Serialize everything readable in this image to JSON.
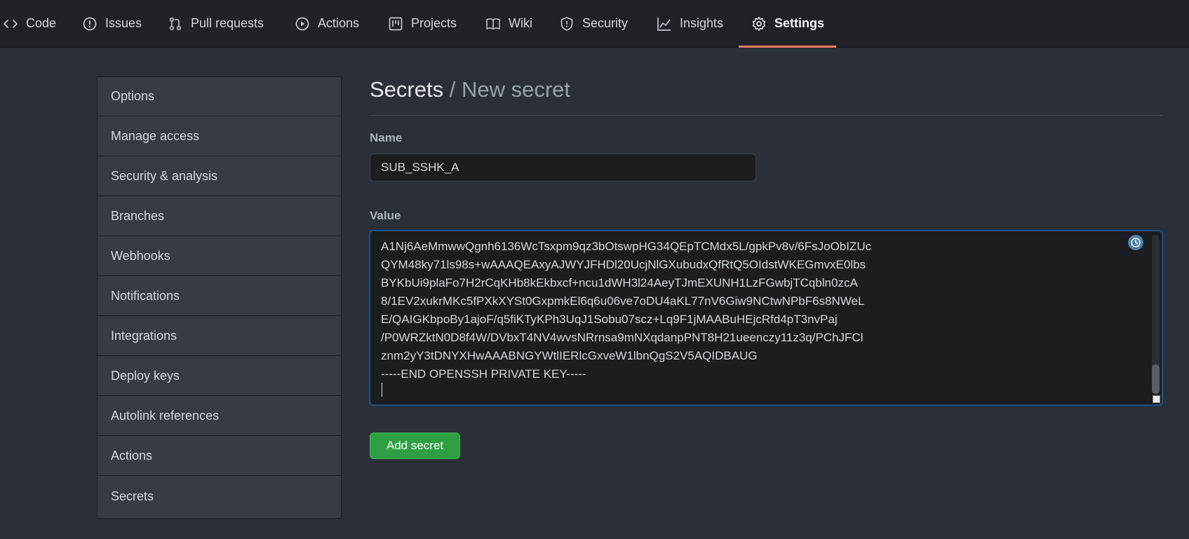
{
  "nav": {
    "tabs": [
      {
        "label": "Code",
        "icon": "code-icon"
      },
      {
        "label": "Issues",
        "icon": "issue-icon"
      },
      {
        "label": "Pull requests",
        "icon": "pull-request-icon"
      },
      {
        "label": "Actions",
        "icon": "play-icon"
      },
      {
        "label": "Projects",
        "icon": "project-icon"
      },
      {
        "label": "Wiki",
        "icon": "book-icon"
      },
      {
        "label": "Security",
        "icon": "shield-icon"
      },
      {
        "label": "Insights",
        "icon": "graph-icon"
      },
      {
        "label": "Settings",
        "icon": "gear-icon",
        "selected": true
      }
    ]
  },
  "sidebar": {
    "items": [
      {
        "label": "Options"
      },
      {
        "label": "Manage access"
      },
      {
        "label": "Security & analysis"
      },
      {
        "label": "Branches"
      },
      {
        "label": "Webhooks"
      },
      {
        "label": "Notifications"
      },
      {
        "label": "Integrations"
      },
      {
        "label": "Deploy keys"
      },
      {
        "label": "Autolink references"
      },
      {
        "label": "Actions"
      },
      {
        "label": "Secrets"
      }
    ]
  },
  "main": {
    "title": "Secrets",
    "title_sub": " / New secret",
    "name_label": "Name",
    "name_value": "SUB_SSHK_A",
    "value_label": "Value",
    "value_lines": [
      "A1Nj6AeMmwwQgnh6136WcTsxpm9qz3bOtswpHG34QEpTCMdx5L/gpkPv8v/6FsJoObIZUc",
      "QYM48ky71ls98s+wAAAQEAxyAJWYJFHDl20UcjNlGXubudxQfRtQ5OIdstWKEGmvxE0lbs",
      "BYKbUi9plaFo7H2rCqKHb8kEkbxcf+ncu1dWH3l24AeyTJmEXUNH1LzFGwbjTCqbln0zcA",
      "8/1EV2xukrMKc5fPXkXYSt0GxpmkEl6q6u06ve7oDU4aKL77nV6Giw9NCtwNPbF6s8NWeL",
      "E/QAIGKbpoBy1ajoF/q5fiKTyKPh3UqJ1Sobu07scz+Lq9F1jMAABuHEjcRfd4pT3nvPaj",
      "/P0WRZktN0D8f4W/DVbxT4NV4wvsNRrnsa9mNXqdanpPNT8H21ueenczy11z3q/PChJFCl",
      "znm2yY3tDNYXHwAAABNGYWtlIERlcGxveW1lbnQgS2V5AQIDBAUG",
      "-----END OPENSSH PRIVATE KEY-----"
    ],
    "submit_label": "Add secret"
  },
  "colors": {
    "accent_underline": "#f47a60",
    "button_green": "#2ea043",
    "focus_border": "#1f4f7a"
  }
}
